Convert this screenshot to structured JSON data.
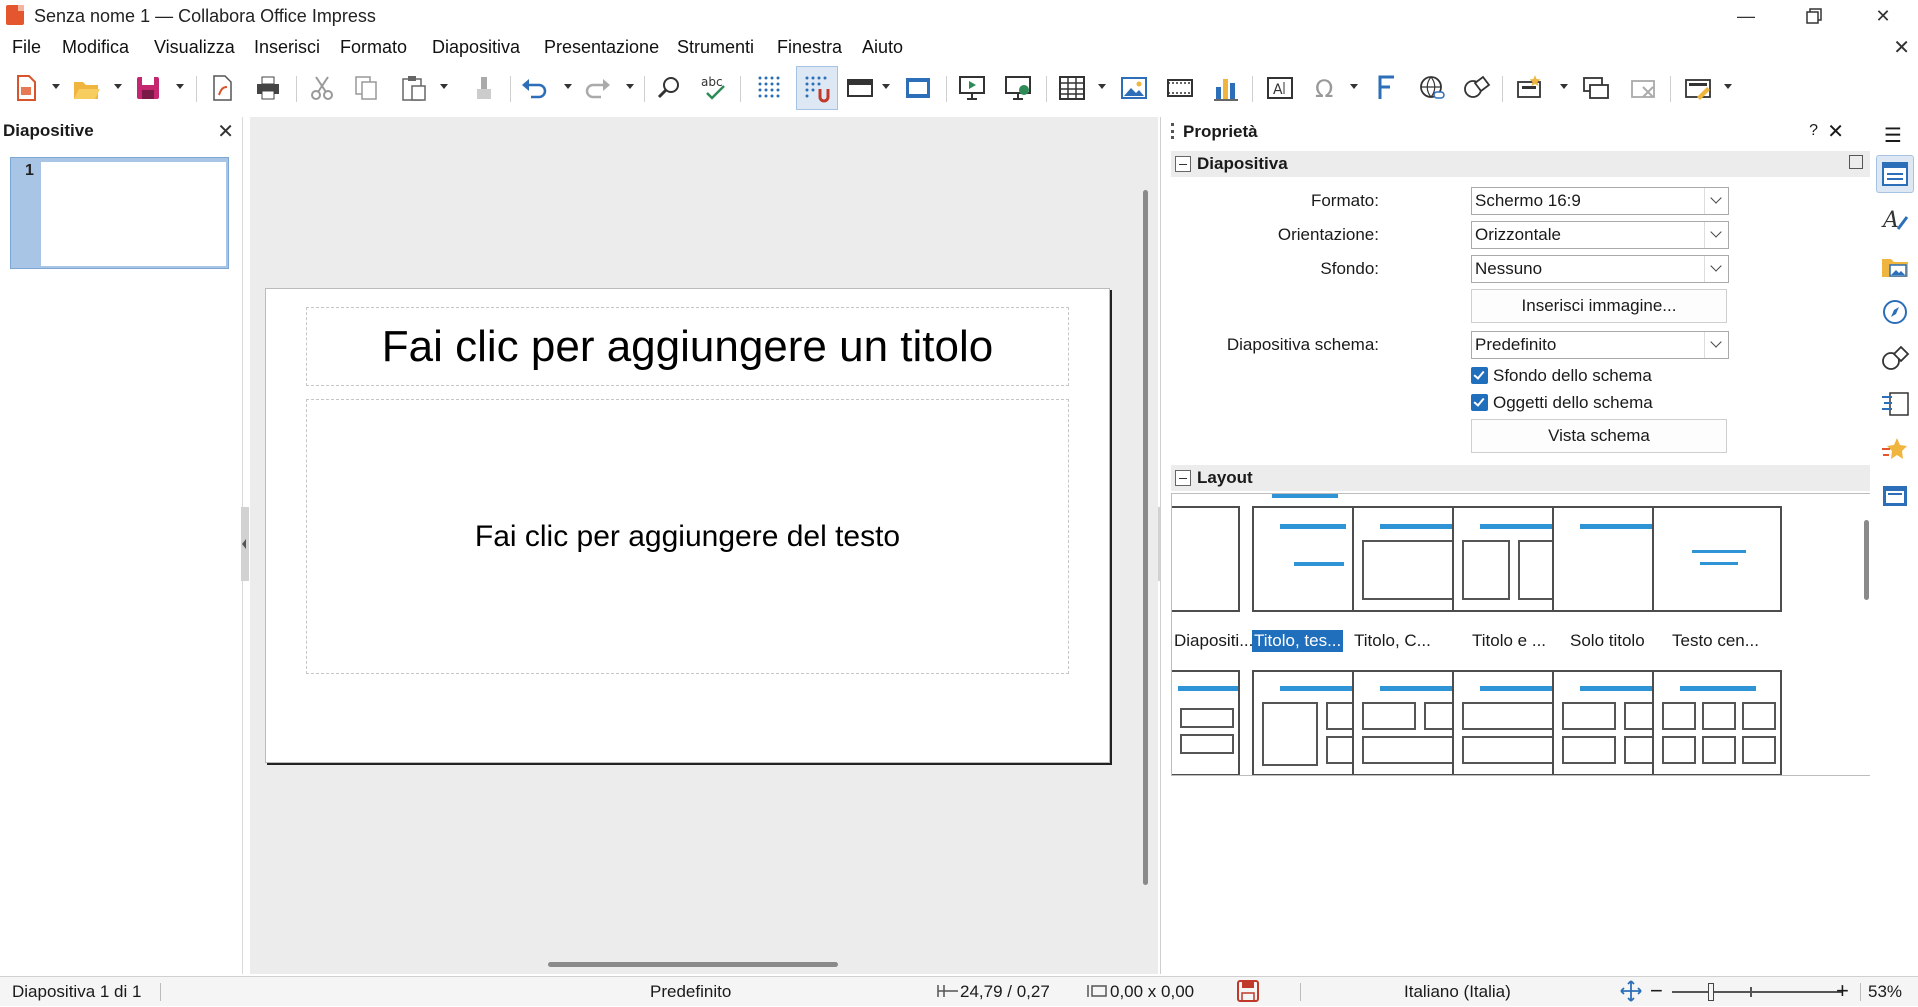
{
  "window": {
    "title": "Senza nome 1 — Collabora Office Impress",
    "minimize_icon": "minimize-icon",
    "maximize_icon": "maximize-icon",
    "close_icon": "close-icon"
  },
  "menu": {
    "items": [
      "File",
      "Modifica",
      "Visualizza",
      "Inserisci",
      "Formato",
      "Diapositiva",
      "Presentazione",
      "Strumenti",
      "Finestra",
      "Aiuto"
    ]
  },
  "toolbar": {
    "icons": [
      "new-document-icon",
      "open-icon",
      "save-icon",
      "export-pdf-icon",
      "print-icon",
      "cut-icon",
      "copy-icon",
      "paste-icon",
      "clone-formatting-icon",
      "undo-icon",
      "redo-icon",
      "find-replace-icon",
      "spellcheck-icon",
      "display-grid-icon",
      "snap-to-grid-icon",
      "display-views-icon",
      "master-slide-icon",
      "start-from-first-icon",
      "start-from-current-icon",
      "insert-table-icon",
      "insert-image-icon",
      "insert-media-icon",
      "insert-chart-icon",
      "insert-textbox-icon",
      "special-character-icon",
      "fontwork-icon",
      "hyperlink-icon",
      "basic-shapes-icon",
      "new-slide-icon",
      "duplicate-slide-icon",
      "delete-slide-icon",
      "slide-layout-icon"
    ]
  },
  "slides_panel": {
    "title": "Diapositive",
    "thumbnails": [
      {
        "number": "1"
      }
    ]
  },
  "slide": {
    "title_placeholder": "Fai clic per aggiungere un titolo",
    "body_placeholder": "Fai clic per aggiungere del testo"
  },
  "properties": {
    "title": "Proprietà",
    "help": "?",
    "slide_section": {
      "label": "Diapositiva",
      "format_label": "Formato:",
      "format_value": "Schermo 16:9",
      "orientation_label": "Orientazione:",
      "orientation_value": "Orizzontale",
      "background_label": "Sfondo:",
      "background_value": "Nessuno",
      "insert_image_button": "Inserisci immagine...",
      "master_label": "Diapositiva schema:",
      "master_value": "Predefinito",
      "master_background_check": "Sfondo dello schema",
      "master_objects_check": "Oggetti dello schema",
      "master_view_button": "Vista schema"
    },
    "layout_section": {
      "label": "Layout",
      "layouts": [
        "Diapositi...",
        "Titolo, tes...",
        "Titolo, C...",
        "Titolo e ...",
        "Solo titolo",
        "Testo cen..."
      ],
      "selected_index": 1
    }
  },
  "sidebar_tabs": [
    "properties-icon",
    "styles-icon",
    "gallery-icon",
    "navigator-icon",
    "shapes-icon",
    "slide-transition-icon",
    "animation-icon",
    "master-slides-icon"
  ],
  "statusbar": {
    "slide_info": "Diapositiva 1 di 1",
    "master": "Predefinito",
    "position": "24,79 / 0,27",
    "size": "0,00 x 0,00",
    "language": "Italiano (Italia)",
    "zoom_minus": "−",
    "zoom_plus": "+",
    "zoom": "53%"
  }
}
